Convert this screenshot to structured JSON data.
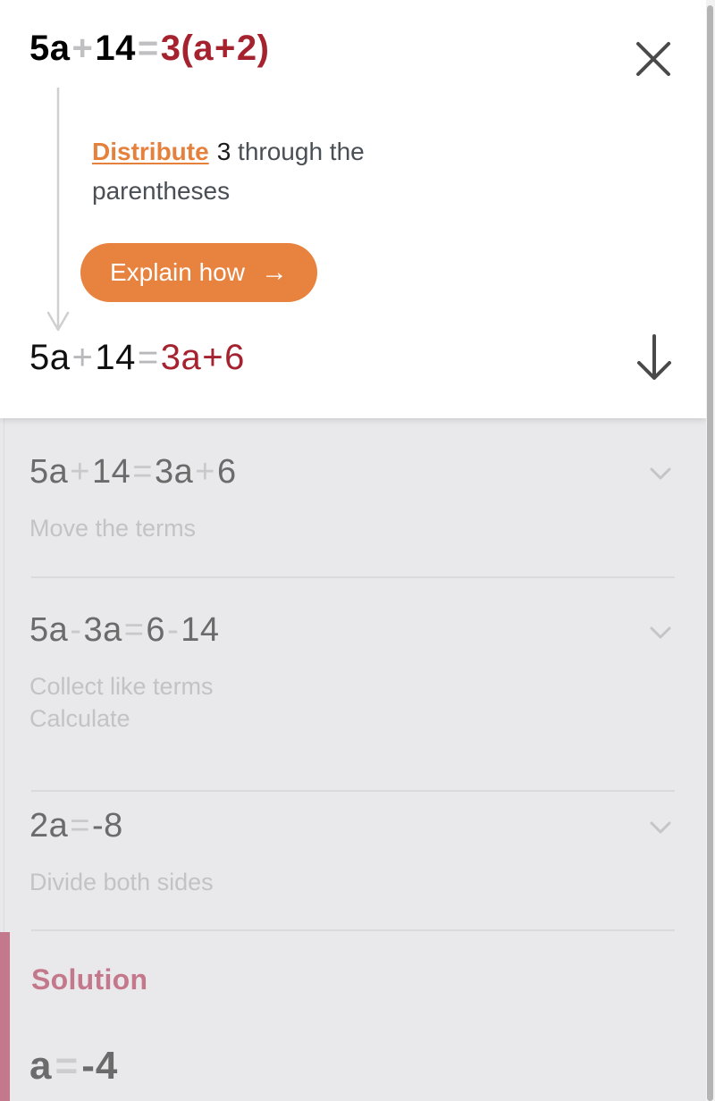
{
  "card": {
    "equation_top": {
      "parts": [
        {
          "t": "5a",
          "c": "black"
        },
        {
          "t": "+",
          "c": "op"
        },
        {
          "t": "14",
          "c": "black"
        },
        {
          "t": "=",
          "c": "op"
        },
        {
          "t": "3",
          "c": "red"
        },
        {
          "t": "(",
          "c": "red"
        },
        {
          "t": "a",
          "c": "red"
        },
        {
          "t": "+",
          "c": "redop"
        },
        {
          "t": "2",
          "c": "red"
        },
        {
          "t": ")",
          "c": "red"
        }
      ],
      "plain": "5a+14=3(a+2)"
    },
    "close_icon": "close-icon",
    "hint": {
      "link_label": "Distribute",
      "number": "3",
      "rest": " through the parentheses"
    },
    "explain_button": {
      "label": "Explain how",
      "arrow": "→"
    },
    "equation_result": {
      "parts": [
        {
          "t": "5a",
          "c": "black"
        },
        {
          "t": "+",
          "c": "op"
        },
        {
          "t": "14",
          "c": "black"
        },
        {
          "t": "=",
          "c": "op"
        },
        {
          "t": "3a",
          "c": "red"
        },
        {
          "t": "+",
          "c": "redop"
        },
        {
          "t": "6",
          "c": "red"
        }
      ],
      "plain": "5a+14=3a+6"
    },
    "down_arrow_icon": "arrow-down-icon",
    "connector_icon": "arrow-down-connector"
  },
  "steps": [
    {
      "equation_parts": [
        {
          "t": "5a",
          "c": "eq"
        },
        {
          "t": "+",
          "c": "op"
        },
        {
          "t": "14",
          "c": "eq"
        },
        {
          "t": "=",
          "c": "op"
        },
        {
          "t": "3a",
          "c": "eq"
        },
        {
          "t": "+",
          "c": "op"
        },
        {
          "t": "6",
          "c": "eq"
        }
      ],
      "equation_plain": "5a+14=3a+6",
      "hint": "Move the terms",
      "chevron": "chevron-down-icon"
    },
    {
      "equation_parts": [
        {
          "t": "5a",
          "c": "eq"
        },
        {
          "t": "-",
          "c": "op"
        },
        {
          "t": "3a",
          "c": "eq"
        },
        {
          "t": "=",
          "c": "op"
        },
        {
          "t": "6",
          "c": "eq"
        },
        {
          "t": "-",
          "c": "op"
        },
        {
          "t": "14",
          "c": "eq"
        }
      ],
      "equation_plain": "5a-3a=6-14",
      "hint": "Collect like terms\nCalculate",
      "chevron": "chevron-down-icon"
    },
    {
      "equation_parts": [
        {
          "t": "2a",
          "c": "eq"
        },
        {
          "t": "=",
          "c": "op"
        },
        {
          "t": "-8",
          "c": "eq"
        }
      ],
      "equation_plain": "2a=-8",
      "hint": "Divide both sides",
      "chevron": "chevron-down-icon"
    }
  ],
  "solution": {
    "label": "Solution",
    "equation_parts": [
      {
        "t": "a",
        "c": "eq"
      },
      {
        "t": "=",
        "c": "op"
      },
      {
        "t": "-4",
        "c": "eq"
      }
    ],
    "equation_plain": "a=-4",
    "accent_color": "#c4788c"
  },
  "colors": {
    "accent_orange": "#e8823f",
    "red": "#a5222f",
    "rose": "#c4788c",
    "overlay_gray": "#e9e9eb"
  }
}
